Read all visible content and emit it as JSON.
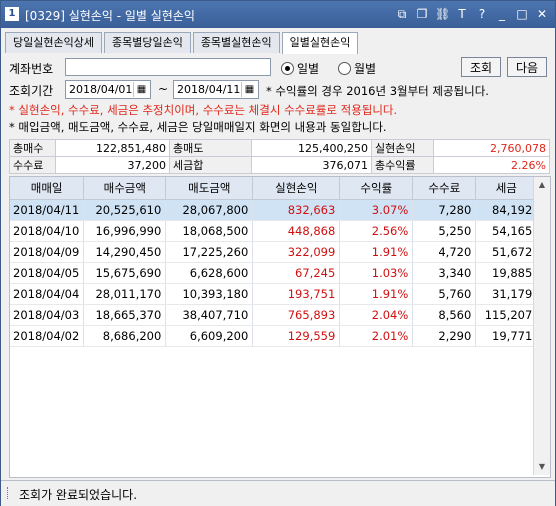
{
  "window": {
    "number": "1",
    "title": "[0329] 실현손익 - 일별 실현손익"
  },
  "title_icons": [
    "restore-icon",
    "copy-icon",
    "link-icon",
    "text-icon",
    "help-icon",
    "minimize-icon",
    "maximize-icon",
    "close-icon"
  ],
  "title_glyphs": {
    "restore": "⧉",
    "copy": "❐",
    "link": "⛓",
    "text": "T",
    "help": "?",
    "minimize": "_",
    "maximize": "□",
    "close": "✕"
  },
  "tabs": [
    {
      "label": "당일실현손익상세",
      "active": false
    },
    {
      "label": "종목별당일손익",
      "active": false
    },
    {
      "label": "종목별실현손익",
      "active": false
    },
    {
      "label": "일별실현손익",
      "active": true
    }
  ],
  "form": {
    "account_label": "계좌번호",
    "account_value": "",
    "radio_daily": "일별",
    "radio_monthly": "월별",
    "search_button": "조회",
    "next_button": "다음",
    "period_label": "조회기간",
    "date_from": "2018/04/01",
    "tilde": "~",
    "date_to": "2018/04/11",
    "period_note": "* 수익률의 경우 2016년 3월부터 제공됩니다."
  },
  "notes": {
    "red": "* 실현손익, 수수료, 세금은 추정치이며, 수수료는 체결시 수수료률로 적용됩니다.",
    "black": "* 매입금액, 매도금액, 수수료, 세금은 당일매매일지 화면의 내용과 동일합니다."
  },
  "summary": {
    "buy_total_label": "총매수",
    "buy_total": "122,851,480",
    "sell_total_label": "총매도",
    "sell_total": "125,400,250",
    "realized_label": "실현손익",
    "realized": "2,760,078",
    "fee_label": "수수료",
    "fee": "37,200",
    "tax_label": "세금합",
    "tax": "376,071",
    "return_label": "총수익률",
    "return": "2.26%"
  },
  "table": {
    "headers": [
      "매매일",
      "매수금액",
      "매도금액",
      "실현손익",
      "수익률",
      "수수료",
      "세금"
    ],
    "rows": [
      [
        "2018/04/11",
        "20,525,610",
        "28,067,800",
        "832,663",
        "3.07%",
        "7,280",
        "84,192"
      ],
      [
        "2018/04/10",
        "16,996,990",
        "18,068,500",
        "448,868",
        "2.56%",
        "5,250",
        "54,165"
      ],
      [
        "2018/04/09",
        "14,290,450",
        "17,225,260",
        "322,099",
        "1.91%",
        "4,720",
        "51,672"
      ],
      [
        "2018/04/05",
        "15,675,690",
        "6,628,600",
        "67,245",
        "1.03%",
        "3,340",
        "19,885"
      ],
      [
        "2018/04/04",
        "28,011,170",
        "10,393,180",
        "193,751",
        "1.91%",
        "5,760",
        "31,179"
      ],
      [
        "2018/04/03",
        "18,665,370",
        "38,407,710",
        "765,893",
        "2.04%",
        "8,560",
        "115,207"
      ],
      [
        "2018/04/02",
        "8,686,200",
        "6,609,200",
        "129,559",
        "2.01%",
        "2,290",
        "19,771"
      ]
    ]
  },
  "status": "조회가 완료되었습니다.",
  "colors": {
    "profit": "#d01010",
    "selected_row": "#cfe3f5",
    "title_bar": "#3a5f98"
  }
}
